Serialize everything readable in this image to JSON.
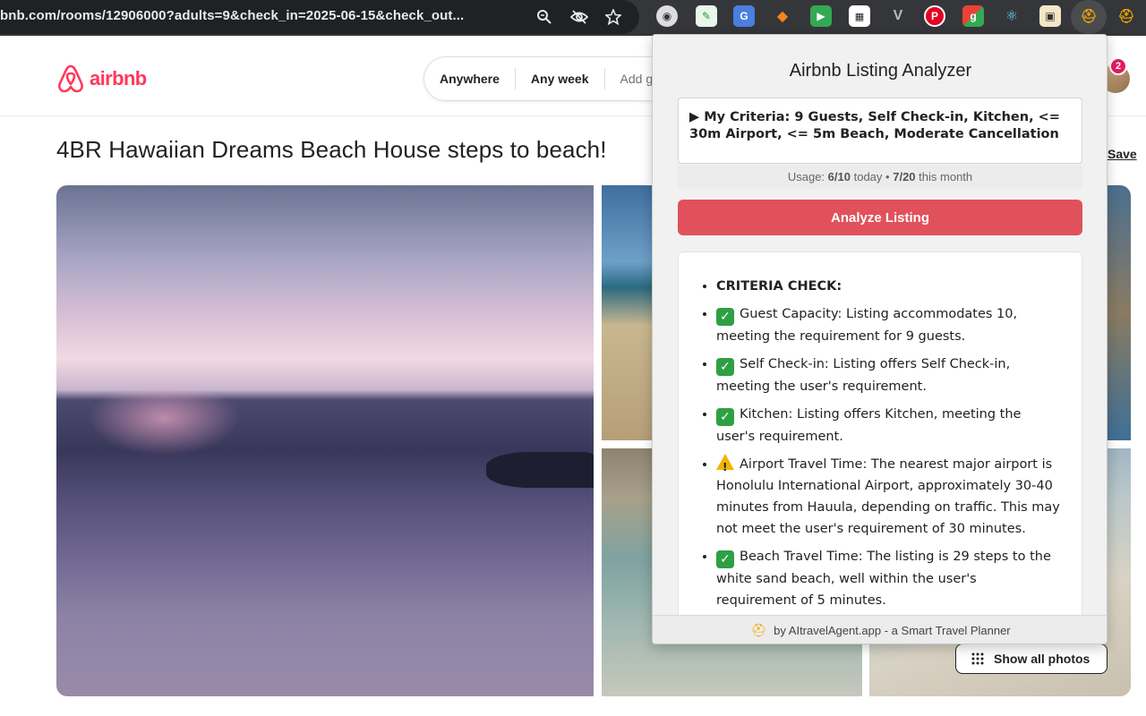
{
  "browser": {
    "url": "bnb.com/rooms/12906000?adults=9&check_in=2025-06-15&check_out...",
    "extensions": [
      {
        "name": "chrome-icon"
      },
      {
        "name": "evernote-icon"
      },
      {
        "name": "translate-icon"
      },
      {
        "name": "metamask-icon"
      },
      {
        "name": "video-icon"
      },
      {
        "name": "qr-code-icon"
      },
      {
        "name": "vue-icon"
      },
      {
        "name": "pinterest-icon"
      },
      {
        "name": "google-icon"
      },
      {
        "name": "react-icon"
      },
      {
        "name": "scanner-icon"
      },
      {
        "name": "aitravelagent-icon"
      }
    ]
  },
  "site": {
    "logo": "airbnb",
    "search": {
      "anywhere": "Anywhere",
      "any_week": "Any week",
      "guests": "Add guests"
    },
    "notification_count": "2"
  },
  "listing": {
    "title": "4BR Hawaiian Dreams Beach House steps to beach!",
    "save_label": "Save",
    "show_all_photos": "Show all photos"
  },
  "popup": {
    "title": "Airbnb Listing Analyzer",
    "criteria_summary": "▶ My Criteria: 9 Guests, Self Check-in, Kitchen, <= 30m Airport, <= 5m Beach, Moderate Cancellation",
    "usage": {
      "label": "Usage:",
      "today": "6/10",
      "today_suffix": "today",
      "separator": "•",
      "month": "7/20",
      "month_suffix": "this month"
    },
    "analyze_button": "Analyze Listing",
    "results_heading": "CRITERIA CHECK:",
    "results": [
      {
        "status": "ok",
        "text": "Guest Capacity: Listing accommodates 10, meeting the requirement for 9 guests."
      },
      {
        "status": "ok",
        "text": "Self Check-in: Listing offers Self Check-in, meeting the user's requirement."
      },
      {
        "status": "ok",
        "text": "Kitchen: Listing offers Kitchen, meeting the user's requirement."
      },
      {
        "status": "warn",
        "text": "Airport Travel Time: The nearest major airport is Honolulu International Airport, approximately 30-40 minutes from Hauula, depending on traffic. This may not meet the user's requirement of 30 minutes."
      },
      {
        "status": "ok",
        "text": "Beach Travel Time: The listing is 29 steps to the white sand beach, well within the user's requirement of 5 minutes."
      }
    ],
    "footer": "by AItravelAgent.app - a Smart Travel Planner"
  },
  "colors": {
    "brand": "#ff385c",
    "analyze_button": "#e0515b",
    "ok": "#2ea043",
    "warn": "#f4b400"
  }
}
